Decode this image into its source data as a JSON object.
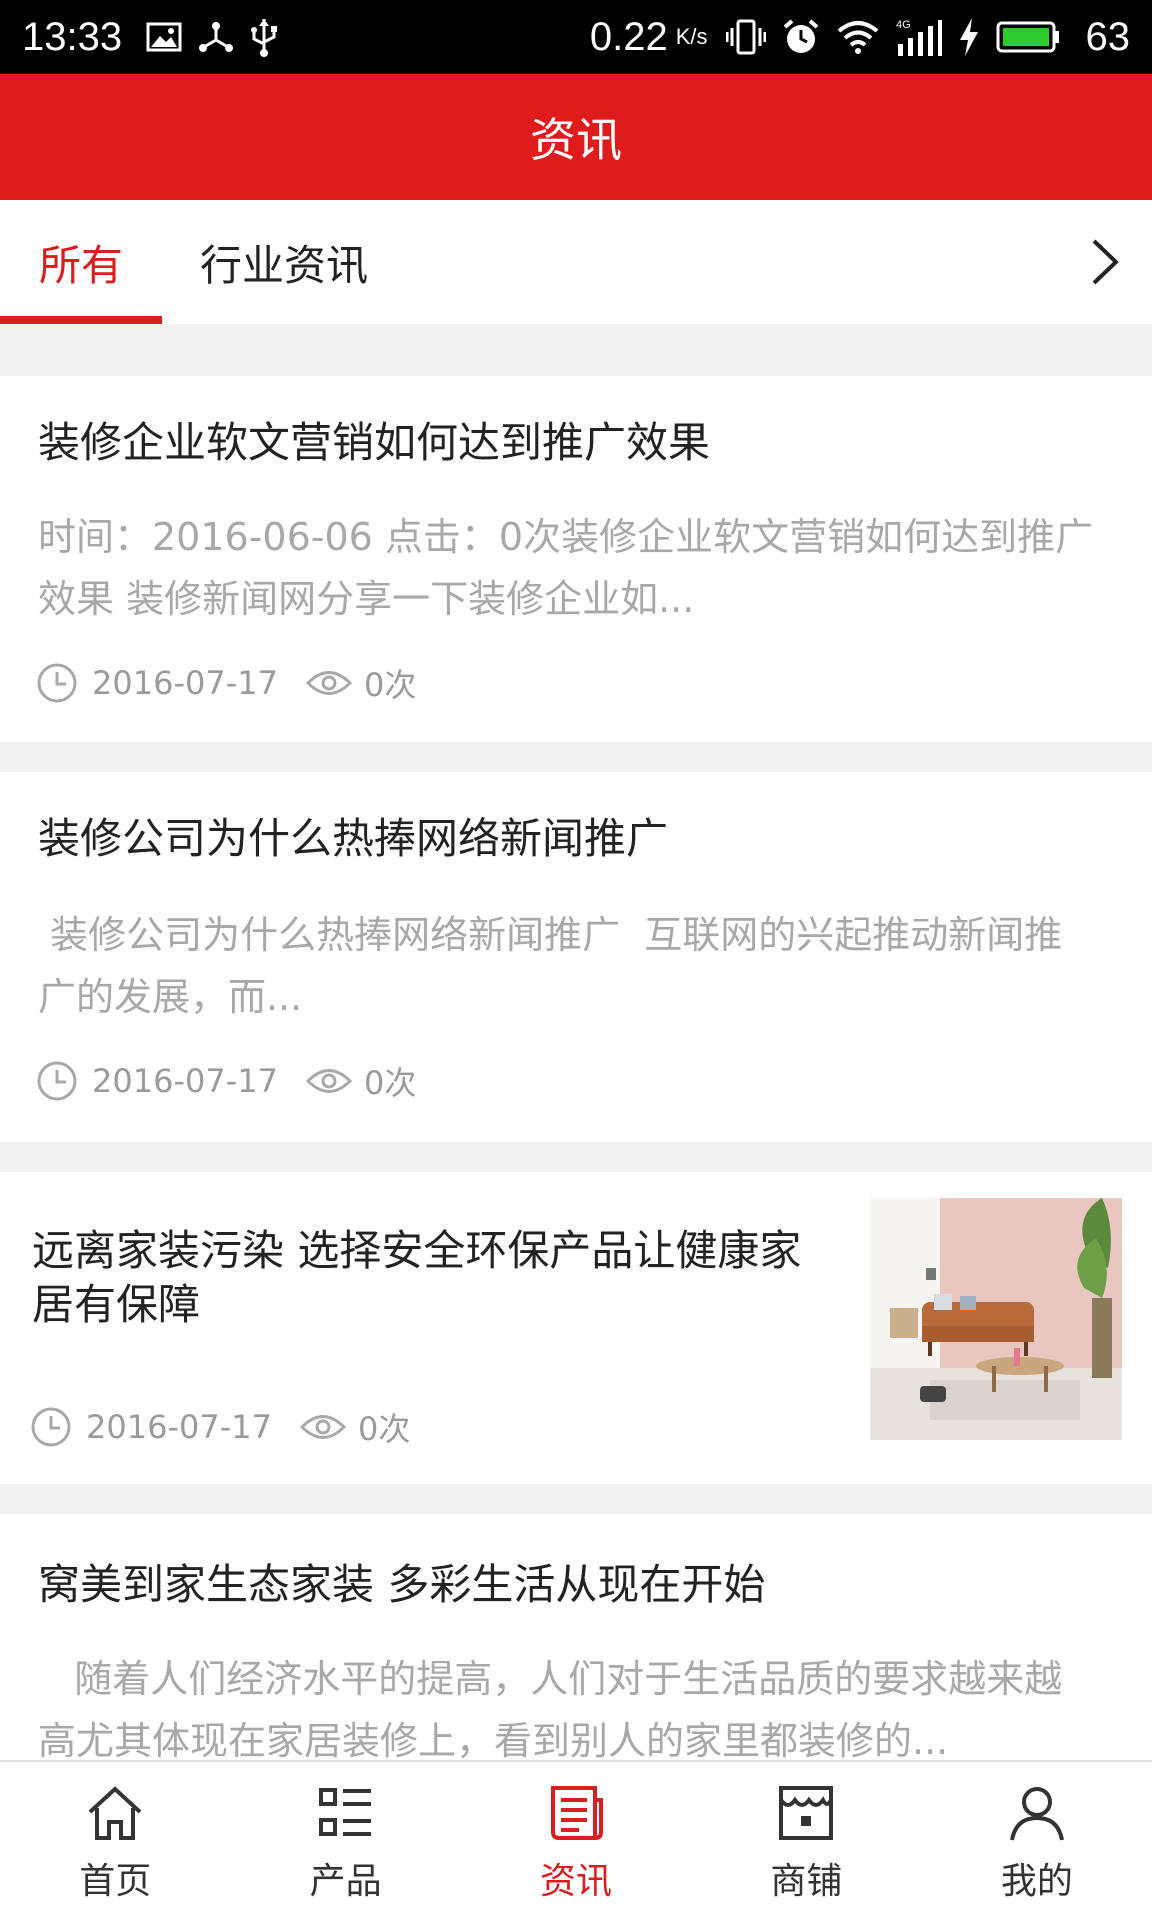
{
  "status_bar": {
    "time": "13:33",
    "speed": "0.22",
    "speed_unit": "K/s",
    "network": "4G",
    "battery_level": "63",
    "icons": [
      "image-icon",
      "usb-share-icon",
      "usb-icon",
      "vibrate-icon",
      "alarm-icon",
      "wifi-icon",
      "signal-icon",
      "charging-icon",
      "battery-icon"
    ]
  },
  "header": {
    "title": "资讯"
  },
  "tabs": {
    "items": [
      {
        "label": "所有",
        "active": true
      },
      {
        "label": "行业资讯",
        "active": false
      }
    ],
    "more_icon": "chevron-right-icon"
  },
  "articles": [
    {
      "title": "装修企业软文营销如何达到推广效果",
      "summary": "时间：2016-06-06 点击：0次装修企业软文营销如何达到推广效果 装修新闻网分享一下装修企业如...",
      "date": "2016-07-17",
      "views": "0次"
    },
    {
      "title": "装修公司为什么热捧网络新闻推广",
      "summary": " 装修公司为什么热捧网络新闻推广  互联网的兴起推动新闻推广的发展，而...",
      "date": "2016-07-17",
      "views": "0次"
    },
    {
      "title": "远离家装污染 选择安全环保产品让健康家居有保障",
      "date": "2016-07-17",
      "views": "0次",
      "has_image": true
    },
    {
      "title": "窝美到家生态家装 多彩生活从现在开始",
      "summary": "   随着人们经济水平的提高，人们对于生活品质的要求越来越高尤其体现在家居装修上，看到别人的家里都装修的..."
    }
  ],
  "bottom_nav": {
    "items": [
      {
        "label": "首页",
        "icon": "home-icon",
        "active": false
      },
      {
        "label": "产品",
        "icon": "list-icon",
        "active": false
      },
      {
        "label": "资讯",
        "icon": "news-icon",
        "active": true
      },
      {
        "label": "商铺",
        "icon": "store-icon",
        "active": false
      },
      {
        "label": "我的",
        "icon": "user-icon",
        "active": false
      }
    ]
  },
  "colors": {
    "accent": "#df1b1b",
    "active_text": "#d81e1e",
    "muted": "#a8a8a8",
    "background": "#f2f2f2"
  }
}
